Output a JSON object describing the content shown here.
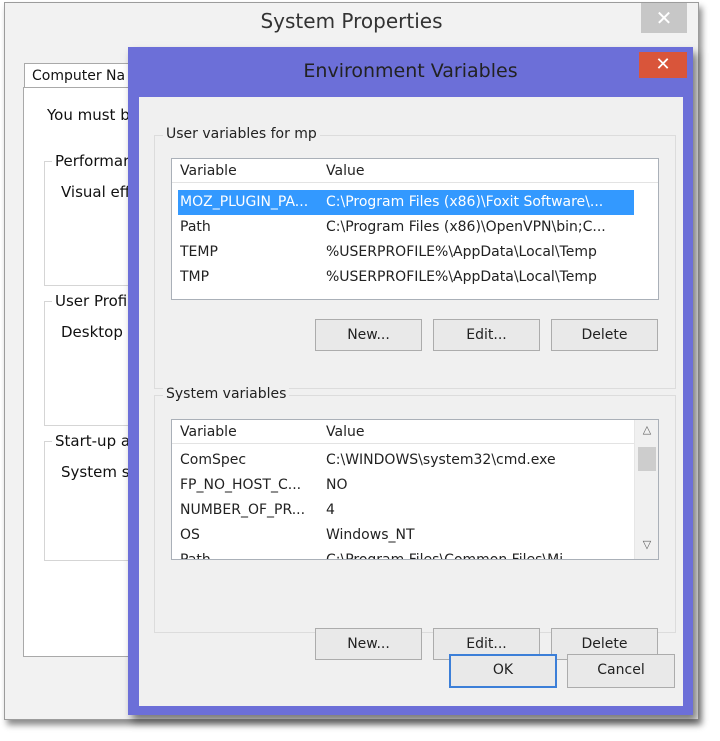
{
  "system_properties": {
    "title": "System Properties",
    "close_glyph": "✕",
    "tab_label": "Computer Na",
    "admin_text": "You must b",
    "performance": {
      "label": "Performar",
      "desc": "Visual eff"
    },
    "user_profiles": {
      "label": "User Profi",
      "desc": "Desktop"
    },
    "startup": {
      "label": "Start-up ar",
      "desc": "System s"
    }
  },
  "environment_variables": {
    "title": "Environment Variables",
    "close_glyph": "✕",
    "user_group_label": "User variables for mp",
    "system_group_label": "System variables",
    "columns": {
      "variable": "Variable",
      "value": "Value"
    },
    "user_vars": [
      {
        "name": "MOZ_PLUGIN_PA...",
        "value": "C:\\Program Files (x86)\\Foxit Software\\...",
        "selected": true
      },
      {
        "name": "Path",
        "value": "C:\\Program Files (x86)\\OpenVPN\\bin;C..."
      },
      {
        "name": "TEMP",
        "value": "%USERPROFILE%\\AppData\\Local\\Temp"
      },
      {
        "name": "TMP",
        "value": "%USERPROFILE%\\AppData\\Local\\Temp"
      }
    ],
    "system_vars": [
      {
        "name": "ComSpec",
        "value": "C:\\WINDOWS\\system32\\cmd.exe"
      },
      {
        "name": "FP_NO_HOST_C...",
        "value": "NO"
      },
      {
        "name": "NUMBER_OF_PR...",
        "value": "4"
      },
      {
        "name": "OS",
        "value": "Windows_NT"
      },
      {
        "name": "Path",
        "value": "C:\\Program Files\\Common Files\\Mi..."
      }
    ],
    "buttons": {
      "new": "New...",
      "edit": "Edit...",
      "delete": "Delete",
      "ok": "OK",
      "cancel": "Cancel"
    },
    "colors": {
      "dialog_frame": "#6c6fd8",
      "close_button": "#d9553a",
      "selection": "#3399ff",
      "default_button_border": "#3c7fd8"
    }
  }
}
